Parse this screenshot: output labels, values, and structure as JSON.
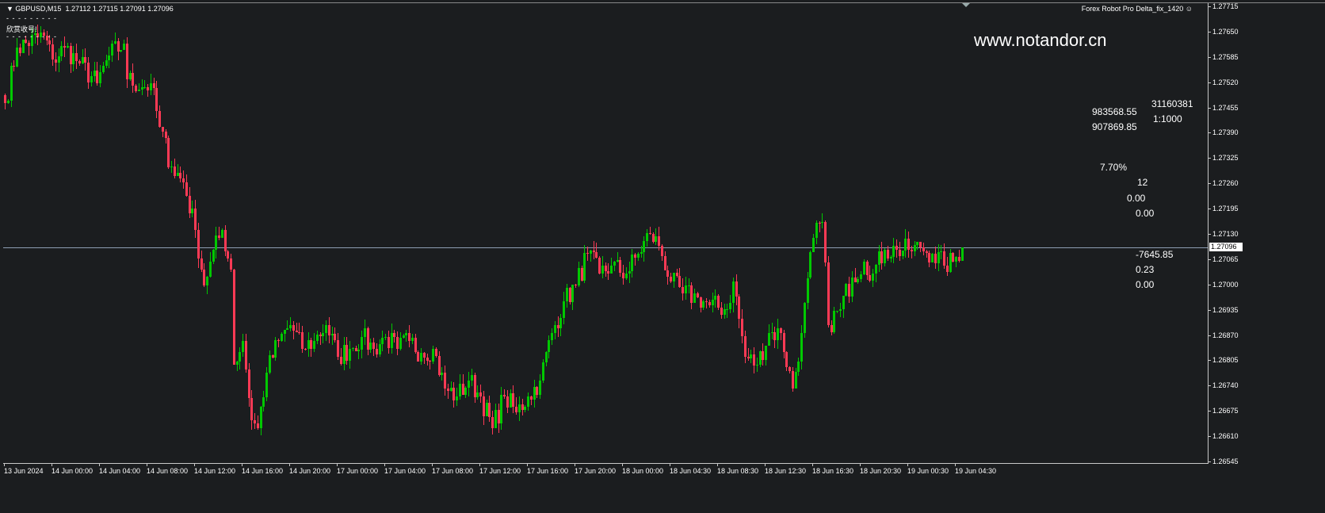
{
  "header": {
    "symbol": "GBPUSD,M15",
    "ohlc": "1.27112 1.27115 1.27091 1.27096",
    "dashes": "- - - - - - - - -",
    "note": "欣赏收号!"
  },
  "ea_label": "Forex Robot Pro Delta_fix_1420",
  "ea_icon": "smiley-icon",
  "watermark": "www.notandor.cn",
  "info": {
    "account": "31160381",
    "leverage": "1:1000",
    "balance": "983568.55",
    "equity": "907869.85",
    "margin_level": "7.70%",
    "orders": "12",
    "v1": "0.00",
    "v2": "0.00",
    "profit": "-7645.85",
    "lots": "0.23",
    "v3": "0.00"
  },
  "colors": {
    "bull": "#00c800",
    "bear": "#ff3a55",
    "bg": "#1b1d1f",
    "current_line": "#8e9db3"
  },
  "chart_data": {
    "type": "candlestick",
    "symbol": "GBPUSD",
    "timeframe": "M15",
    "current_price": 1.27096,
    "current_price_label": "1.27096",
    "ylim": [
      1.26545,
      1.27715
    ],
    "y_ticks": [
      "1.27715",
      "1.27650",
      "1.27585",
      "1.27520",
      "1.27455",
      "1.27390",
      "1.27325",
      "1.27260",
      "1.27195",
      "1.27130",
      "1.27065",
      "1.27000",
      "1.26935",
      "1.26870",
      "1.26805",
      "1.26740",
      "1.26675",
      "1.26610",
      "1.26545"
    ],
    "x_ticks": [
      "13 Jun 2024",
      "14 Jun 00:00",
      "14 Jun 04:00",
      "14 Jun 08:00",
      "14 Jun 12:00",
      "14 Jun 16:00",
      "14 Jun 20:00",
      "17 Jun 00:00",
      "17 Jun 04:00",
      "17 Jun 08:00",
      "17 Jun 12:00",
      "17 Jun 16:00",
      "17 Jun 20:00",
      "18 Jun 00:00",
      "18 Jun 04:30",
      "18 Jun 08:30",
      "18 Jun 12:30",
      "18 Jun 16:30",
      "18 Jun 20:30",
      "19 Jun 00:30",
      "19 Jun 04:30"
    ],
    "candles_per_tick": 16,
    "close_path": [
      [
        0,
        1.27466
      ],
      [
        4,
        1.27609
      ],
      [
        13,
        1.2764
      ],
      [
        16,
        1.27578
      ],
      [
        20,
        1.27609
      ],
      [
        25,
        1.27568
      ],
      [
        31,
        1.27517
      ],
      [
        35,
        1.27589
      ],
      [
        40,
        1.27619
      ],
      [
        41,
        1.27528
      ],
      [
        47,
        1.27507
      ],
      [
        49,
        1.27517
      ],
      [
        52,
        1.27405
      ],
      [
        56,
        1.27303
      ],
      [
        60,
        1.27263
      ],
      [
        64,
        1.2714
      ],
      [
        67,
        1.26998
      ],
      [
        69,
        1.27059
      ],
      [
        73,
        1.2714
      ],
      [
        76,
        1.27038
      ],
      [
        77,
        1.26794
      ],
      [
        80,
        1.26855
      ],
      [
        83,
        1.26651
      ],
      [
        85,
        1.26631
      ],
      [
        88,
        1.26773
      ],
      [
        92,
        1.26855
      ],
      [
        96,
        1.26896
      ],
      [
        100,
        1.26835
      ],
      [
        104,
        1.26855
      ],
      [
        108,
        1.26896
      ],
      [
        112,
        1.26814
      ],
      [
        116,
        1.26835
      ],
      [
        120,
        1.26865
      ],
      [
        124,
        1.26835
      ],
      [
        128,
        1.26865
      ],
      [
        132,
        1.26835
      ],
      [
        136,
        1.26855
      ],
      [
        140,
        1.26824
      ],
      [
        144,
        1.26835
      ],
      [
        148,
        1.26733
      ],
      [
        152,
        1.26712
      ],
      [
        156,
        1.26753
      ],
      [
        160,
        1.26712
      ],
      [
        164,
        1.26631
      ],
      [
        168,
        1.26712
      ],
      [
        172,
        1.26672
      ],
      [
        176,
        1.26712
      ],
      [
        180,
        1.26753
      ],
      [
        184,
        1.26875
      ],
      [
        188,
        1.26957
      ],
      [
        192,
        1.26998
      ],
      [
        196,
        1.27079
      ],
      [
        200,
        1.27028
      ],
      [
        204,
        1.27049
      ],
      [
        209,
        1.27028
      ],
      [
        213,
        1.27079
      ],
      [
        217,
        1.2713
      ],
      [
        220,
        1.271
      ],
      [
        224,
        1.27008
      ],
      [
        228,
        1.26977
      ],
      [
        233,
        1.26967
      ],
      [
        237,
        1.26947
      ],
      [
        243,
        1.26937
      ],
      [
        245,
        1.27008
      ],
      [
        249,
        1.26814
      ],
      [
        253,
        1.26794
      ],
      [
        257,
        1.26875
      ],
      [
        261,
        1.26875
      ],
      [
        265,
        1.26733
      ],
      [
        268,
        1.26875
      ],
      [
        272,
        1.2712
      ],
      [
        275,
        1.27161
      ],
      [
        277,
        1.26896
      ],
      [
        281,
        1.26937
      ],
      [
        285,
        1.27018
      ],
      [
        289,
        1.27059
      ],
      [
        292,
        1.27028
      ],
      [
        296,
        1.27089
      ],
      [
        300,
        1.27089
      ],
      [
        304,
        1.27089
      ],
      [
        308,
        1.27095
      ],
      [
        312,
        1.27079
      ],
      [
        316,
        1.27049
      ],
      [
        319,
        1.27059
      ],
      [
        322,
        1.27096
      ]
    ]
  }
}
